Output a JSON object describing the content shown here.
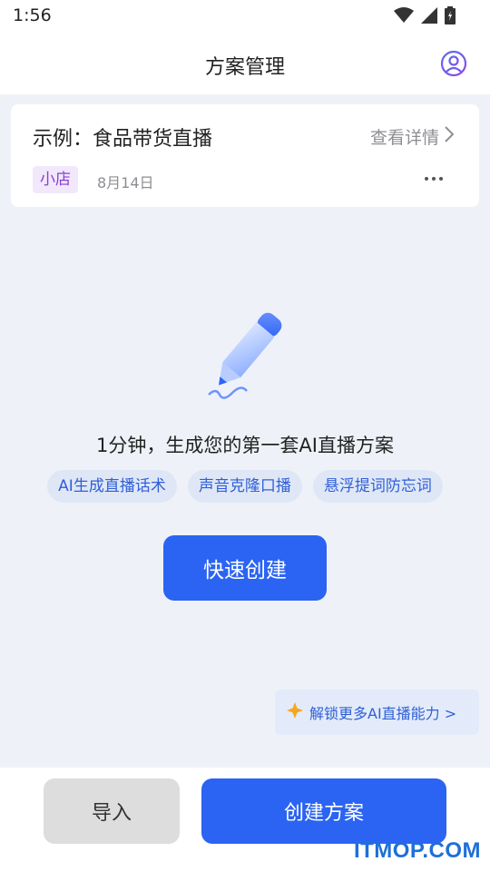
{
  "status_bar": {
    "time": "1:56",
    "icons": [
      "wifi-icon",
      "signal-icon",
      "battery-icon"
    ]
  },
  "header": {
    "title": "方案管理",
    "profile_icon": "user-circle-icon"
  },
  "plan_card": {
    "title": "示例：食品带货直播",
    "detail_label": "查看详情",
    "tag": "小店",
    "date": "8月14日"
  },
  "empty_state": {
    "illustration": "pen-icon",
    "headline": "1分钟，生成您的第一套AI直播方案",
    "features": [
      "AI生成直播话术",
      "声音克隆口播",
      "悬浮提词防忘词"
    ],
    "quick_create_label": "快速创建"
  },
  "unlock": {
    "label": "解锁更多AI直播能力 >"
  },
  "bottom_bar": {
    "import_label": "导入",
    "create_label": "创建方案"
  },
  "watermark": "ITMOP.COM",
  "colors": {
    "accent": "#2b64f2",
    "page_bg": "#eef2f8",
    "tag_purple": "#8a3fd1"
  }
}
